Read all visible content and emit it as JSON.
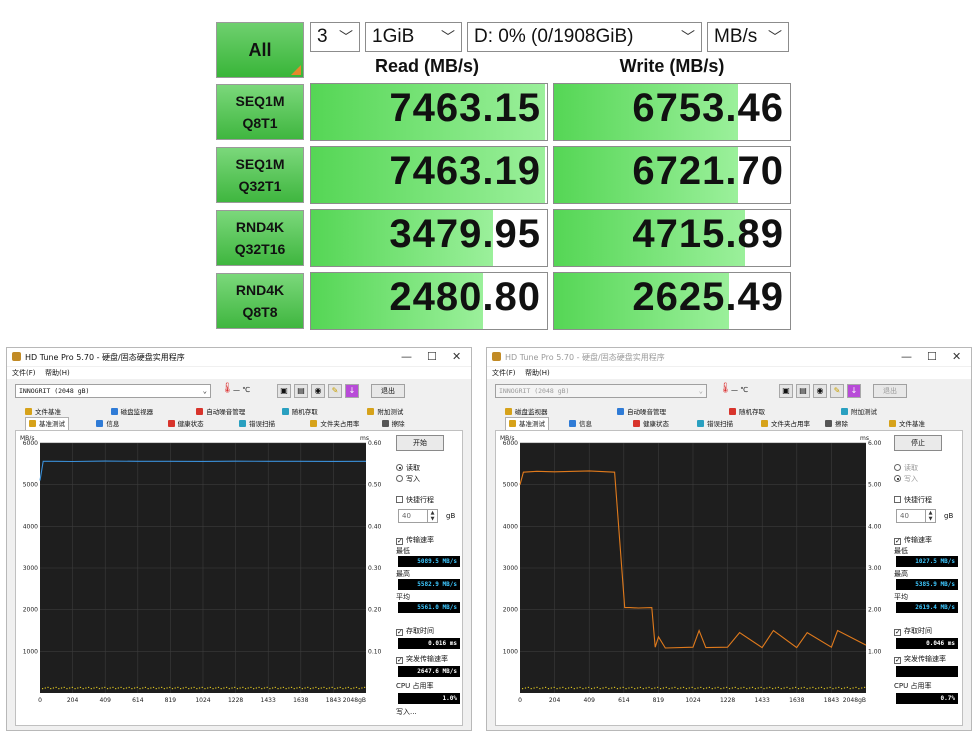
{
  "cdm": {
    "all_label": "All",
    "count": "3",
    "size": "1GiB",
    "drive": "D: 0% (0/1908GiB)",
    "unit": "MB/s",
    "read_header": "Read (MB/s)",
    "write_header": "Write (MB/s)",
    "rows": [
      {
        "l1": "SEQ1M",
        "l2": "Q8T1",
        "read": "7463.15",
        "write": "6753.46",
        "read_fill": 0.99,
        "write_fill": 0.78
      },
      {
        "l1": "SEQ1M",
        "l2": "Q32T1",
        "read": "7463.19",
        "write": "6721.70",
        "read_fill": 0.99,
        "write_fill": 0.78
      },
      {
        "l1": "RND4K",
        "l2": "Q32T16",
        "read": "3479.95",
        "write": "4715.89",
        "read_fill": 0.77,
        "write_fill": 0.81
      },
      {
        "l1": "RND4K",
        "l2": "Q8T8",
        "read": "2480.80",
        "write": "2625.49",
        "read_fill": 0.73,
        "write_fill": 0.74
      }
    ]
  },
  "hdtune_left": {
    "title": "HD Tune Pro 5.70 - 硬盘/固态硬盘实用程序",
    "menu_file": "文件(F)",
    "menu_help": "帮助(H)",
    "drive": "INNOGRIT (2048 gB)",
    "temp": "— ℃",
    "exit": "退出",
    "tabs_top": [
      "文件基准",
      "磁盘监视器",
      "自动噪音管理",
      "随机存取",
      "附加测试"
    ],
    "tabs_bottom": [
      "基准测试",
      "信息",
      "健康状态",
      "错误扫描",
      "文件夹占用率",
      "擦除"
    ],
    "start_btn": "开始",
    "read_label": "读取",
    "write_label": "写入",
    "short_stroke": "快捷行程",
    "stroke_value": "40",
    "stroke_unit": "gB",
    "transfer_rate": "传输速率",
    "min_label": "最低",
    "min_value": "5089.5 MB/s",
    "max_label": "最高",
    "max_value": "5582.9 MB/s",
    "avg_label": "平均",
    "avg_value": "5561.0 MB/s",
    "access_time": "存取时间",
    "access_value": "0.016 ms",
    "burst_rate": "突发传输速率",
    "burst_value": "2647.6 MB/s",
    "cpu_label": "CPU 占用率",
    "cpu_value": "1.0%",
    "y_unit": "MB/s",
    "y2_unit": "ms",
    "y_ticks": [
      "6000",
      "5000",
      "4000",
      "3000",
      "2000",
      "1000"
    ],
    "y2_ticks": [
      "0.60",
      "0.50",
      "0.40",
      "0.30",
      "0.20",
      "0.10"
    ],
    "x_ticks": [
      "0",
      "204",
      "409",
      "614",
      "819",
      "1024",
      "1228",
      "1433",
      "1638",
      "1843",
      "2048gB"
    ],
    "cut_text": "写入..."
  },
  "hdtune_right": {
    "title": "HD Tune Pro 5.70 - 硬盘/固态硬盘实用程序",
    "menu_file": "文件(F)",
    "menu_help": "帮助(H)",
    "drive": "INNOGRIT (2048 gB)",
    "temp": "— ℃",
    "exit": "退出",
    "tabs_top": [
      "磁盘监视器",
      "自动噪音管理",
      "随机存取",
      "附加测试"
    ],
    "tabs_bottom": [
      "基准测试",
      "信息",
      "健康状态",
      "错误扫描",
      "文件夹占用率",
      "擦除",
      "文件基准"
    ],
    "stop_btn": "停止",
    "read_label": "读取",
    "write_label": "写入",
    "short_stroke": "快捷行程",
    "stroke_value": "40",
    "stroke_unit": "gB",
    "transfer_rate": "传输速率",
    "min_label": "最低",
    "min_value": "1027.5 MB/s",
    "max_label": "最高",
    "max_value": "5385.9 MB/s",
    "avg_label": "平均",
    "avg_value": "2619.4 MB/s",
    "access_time": "存取时间",
    "access_value": "0.046 ms",
    "burst_rate": "突发传输速率",
    "burst_value": "",
    "cpu_label": "CPU 占用率",
    "cpu_value": "0.7%",
    "y_unit": "MB/s",
    "y2_unit": "ms",
    "y_ticks": [
      "6000",
      "5000",
      "4000",
      "3000",
      "2000",
      "1000"
    ],
    "y2_ticks": [
      "6.00",
      "5.00",
      "4.00",
      "3.00",
      "2.00",
      "1.00"
    ],
    "x_ticks": [
      "0",
      "204",
      "409",
      "614",
      "819",
      "1024",
      "1228",
      "1433",
      "1638",
      "1843",
      "2048gB"
    ]
  },
  "colors": {
    "left_line": "#3a8fd8",
    "right_line": "#e07a1c",
    "grid": "#3c3c3c",
    "plot_bg": "#1e1e1e",
    "bar_green": "#55d655"
  },
  "chart_data": [
    {
      "type": "line",
      "ylabel": "MB/s",
      "ylim": [
        0,
        6000
      ],
      "x": [
        0,
        20,
        100,
        204,
        409,
        614,
        819,
        1024,
        1228,
        1433,
        1638,
        1843,
        2048
      ],
      "series": [
        {
          "values": [
            5100,
            5560,
            5560,
            5555,
            5565,
            5560,
            5562,
            5558,
            5563,
            5560,
            5561,
            5559,
            5560
          ]
        }
      ],
      "y2label": "ms",
      "y2lim": [
        0,
        0.6
      ]
    },
    {
      "type": "line",
      "ylabel": "MB/s",
      "ylim": [
        0,
        6000
      ],
      "x": [
        0,
        20,
        100,
        204,
        409,
        560,
        620,
        650,
        700,
        780,
        800,
        820,
        860,
        1024,
        1060,
        1100,
        1228,
        1300,
        1433,
        1500,
        1638,
        1700,
        1843,
        1880,
        2048
      ],
      "series": [
        {
          "values": [
            5000,
            5300,
            5320,
            5310,
            5330,
            5300,
            2050,
            2050,
            2040,
            2050,
            1100,
            1350,
            1080,
            1100,
            1500,
            1090,
            1100,
            1450,
            1090,
            1500,
            1090,
            1450,
            1100,
            1500,
            1150
          ]
        }
      ],
      "y2label": "ms",
      "y2lim": [
        0,
        6
      ]
    }
  ]
}
